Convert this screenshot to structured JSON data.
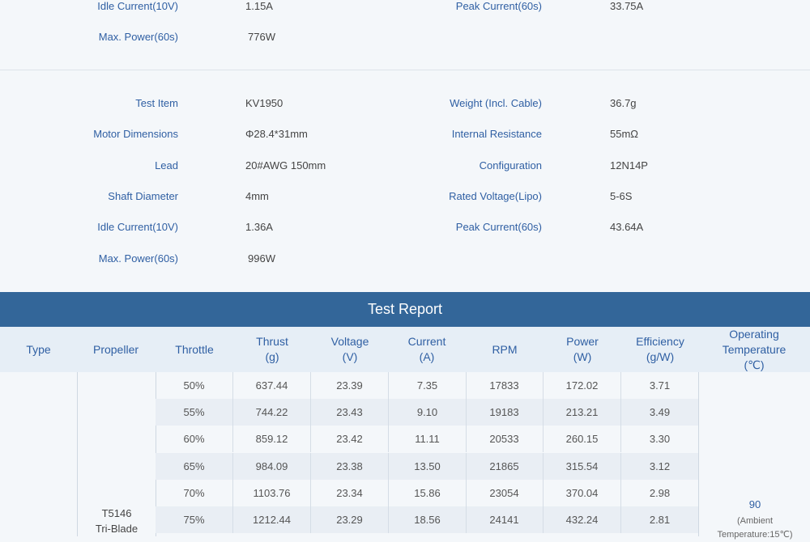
{
  "spec_top": {
    "rows": [
      {
        "left_label": "Idle Current(10V)",
        "left_value": "1.15A",
        "right_label": "Peak Current(60s)",
        "right_value": "33.75A"
      },
      {
        "left_label": "Max. Power(60s)",
        "left_value": "776W",
        "right_label": "",
        "right_value": ""
      }
    ]
  },
  "spec_main": {
    "rows": [
      {
        "left_label": "Test Item",
        "left_value": "KV1950",
        "right_label": "Weight (Incl. Cable)",
        "right_value": "36.7g"
      },
      {
        "left_label": "Motor Dimensions",
        "left_value": "Φ28.4*31mm",
        "right_label": "Internal Resistance",
        "right_value": "55mΩ"
      },
      {
        "left_label": "Lead",
        "left_value": "20#AWG 150mm",
        "right_label": "Configuration",
        "right_value": "12N14P"
      },
      {
        "left_label": "Shaft Diameter",
        "left_value": "4mm",
        "right_label": "Rated Voltage(Lipo)",
        "right_value": "5-6S"
      },
      {
        "left_label": "Idle Current(10V)",
        "left_value": "1.36A",
        "right_label": "Peak Current(60s)",
        "right_value": "43.64A"
      },
      {
        "left_label": "Max. Power(60s)",
        "left_value": "996W",
        "right_label": "",
        "right_value": ""
      }
    ]
  },
  "report": {
    "title": "Test Report",
    "headers": {
      "type": "Type",
      "propeller": "Propeller",
      "throttle": "Throttle",
      "thrust": [
        "Thrust",
        "(g)"
      ],
      "voltage": [
        "Voltage",
        "(V)"
      ],
      "current": [
        "Current",
        "(A)"
      ],
      "rpm": "RPM",
      "power": [
        "Power",
        "(W)"
      ],
      "efficiency": [
        "Efficiency",
        "(g/W)"
      ],
      "temp": [
        "Operating",
        "Temperature",
        "(℃)"
      ]
    },
    "propeller_name": [
      "T5146",
      "Tri-Blade"
    ],
    "temperature_value": "90",
    "temperature_note": [
      "(Ambient",
      "Temperature:15℃)"
    ],
    "rows": [
      [
        "50%",
        "637.44",
        "23.39",
        "7.35",
        "17833",
        "172.02",
        "3.71"
      ],
      [
        "55%",
        "744.22",
        "23.43",
        "9.10",
        "19183",
        "213.21",
        "3.49"
      ],
      [
        "60%",
        "859.12",
        "23.42",
        "11.11",
        "20533",
        "260.15",
        "3.30"
      ],
      [
        "65%",
        "984.09",
        "23.38",
        "13.50",
        "21865",
        "315.54",
        "3.12"
      ],
      [
        "70%",
        "1103.76",
        "23.34",
        "15.86",
        "23054",
        "370.04",
        "2.98"
      ],
      [
        "75%",
        "1212.44",
        "23.29",
        "18.56",
        "24141",
        "432.24",
        "2.81"
      ]
    ]
  }
}
